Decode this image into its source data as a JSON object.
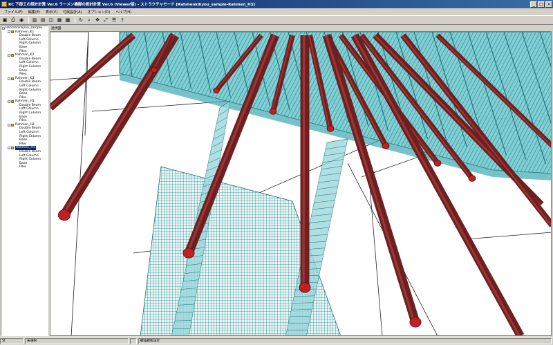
{
  "window": {
    "title": "RC 下部工の設計計算 Ver.6 ラーメン橋脚の設計計算 Ver.6 (Viewer版) - ストラクチャモード [Rahmenkikyou_sample-Rahmen_H3]",
    "minimize_icon": "minimize-icon",
    "maximize_icon": "maximize-icon",
    "close_icon": "close-icon"
  },
  "menu": [
    "ファイル(F)",
    "編集(E)",
    "表示(V)",
    "付属設計(A)",
    "オプション(O)",
    "ヘルプ(H)"
  ],
  "toolbar": {
    "groups": [
      [
        "save-icon",
        "print-icon",
        "camera-icon"
      ],
      [
        "view-front-icon",
        "view-side-icon",
        "view-iso-icon",
        "grid-icon",
        "table-icon"
      ],
      [
        "rotate-icon",
        "zoom-icon",
        "pan-icon",
        "fit-icon",
        "rebar-icon",
        "export-icon"
      ]
    ],
    "glyphs": {
      "save-icon": "▣",
      "print-icon": "⎙",
      "camera-icon": "◉",
      "view-front-icon": "▥",
      "view-side-icon": "▤",
      "view-iso-icon": "◫",
      "grid-icon": "▦",
      "table-icon": "▩",
      "rotate-icon": "↻",
      "zoom-icon": "⌕",
      "pan-icon": "✥",
      "fit-icon": "⤢",
      "rebar-icon": "☰",
      "export-icon": "⇪"
    }
  },
  "tree": {
    "root": "Rahmenkikyou_sample",
    "nodes": [
      {
        "label": "Rahmen_K1",
        "children": [
          "Double Beam",
          "Left Column",
          "Right Column",
          "Base",
          "Piles"
        ]
      },
      {
        "label": "Rahmen_K2",
        "children": [
          "Double Beam",
          "Left Column",
          "Right Column",
          "Base",
          "Piles"
        ]
      },
      {
        "label": "Rahmen_K3",
        "children": [
          "Double Beam",
          "Left Column",
          "Right Column",
          "Base",
          "Piles"
        ]
      },
      {
        "label": "Rahmen_H1",
        "children": [
          "Double Beam",
          "Left Column",
          "Right Column",
          "Base",
          "Piles"
        ]
      },
      {
        "label": "Rahmen_H2",
        "children": [
          "Double Beam",
          "Left Column",
          "Right Column",
          "Base",
          "Piles"
        ]
      },
      {
        "label": "Rahmen_H3",
        "selected": true,
        "children": [
          "Double Beam",
          "Left Column",
          "Right Column",
          "Base",
          "Piles"
        ]
      }
    ]
  },
  "viewport": {
    "tab_label": "透視図",
    "colors": {
      "pile": "#6e1f1f",
      "pile_highlight": "#b04040",
      "pile_tip": "#c02020",
      "rebar": "#3ca8b0",
      "rebar_light": "#9ad8dc",
      "mesh": "#1c6f78",
      "edge_line": "#202020"
    }
  },
  "status": {
    "cells": [
      "SI",
      "未選択",
      "",
      "補強鋼板設計"
    ]
  }
}
